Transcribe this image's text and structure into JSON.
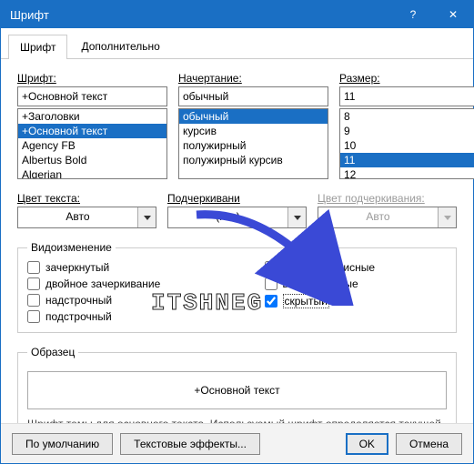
{
  "window": {
    "title": "Шрифт"
  },
  "tabs": [
    {
      "label": "Шрифт",
      "active": true
    },
    {
      "label": "Дополнительно",
      "active": false
    }
  ],
  "font": {
    "label": "Шрифт:",
    "value": "+Основной текст",
    "options": [
      "+Заголовки",
      "+Основной текст",
      "Agency FB",
      "Albertus Bold",
      "Algerian"
    ],
    "selected_index": 1
  },
  "style": {
    "label": "Начертание:",
    "value": "обычный",
    "options": [
      "обычный",
      "курсив",
      "полужирный",
      "полужирный курсив"
    ],
    "selected_index": 0
  },
  "size": {
    "label": "Размер:",
    "value": "11",
    "options": [
      "8",
      "9",
      "10",
      "11",
      "12"
    ],
    "selected_index": 3
  },
  "color": {
    "label": "Цвет текста:",
    "value": "Авто"
  },
  "underline": {
    "label": "Подчеркивани",
    "value": "(нет)"
  },
  "underline_color": {
    "label": "Цвет подчеркивания:",
    "value": "Авто"
  },
  "effects": {
    "legend": "Видоизменение",
    "left": [
      {
        "label": "зачеркнутый",
        "checked": false
      },
      {
        "label": "двойное зачеркивание",
        "checked": false
      },
      {
        "label": "надстрочный",
        "checked": false
      },
      {
        "label": "подстрочный",
        "checked": false
      }
    ],
    "right": [
      {
        "label": "малые прописные",
        "checked": false
      },
      {
        "label": "все прописные",
        "checked": false
      },
      {
        "label": "скрытый",
        "checked": true
      }
    ]
  },
  "sample": {
    "legend": "Образец",
    "text": "+Основной текст"
  },
  "hint": "Шрифт темы для основного текста. Используемый шрифт определяется текущей темой документа.",
  "footer": {
    "default_btn": "По умолчанию",
    "text_effects": "Текстовые эффекты...",
    "ok": "OK",
    "cancel": "Отмена"
  },
  "watermark": "ITSHNEG",
  "icons": {
    "help": "?",
    "close": "✕"
  }
}
